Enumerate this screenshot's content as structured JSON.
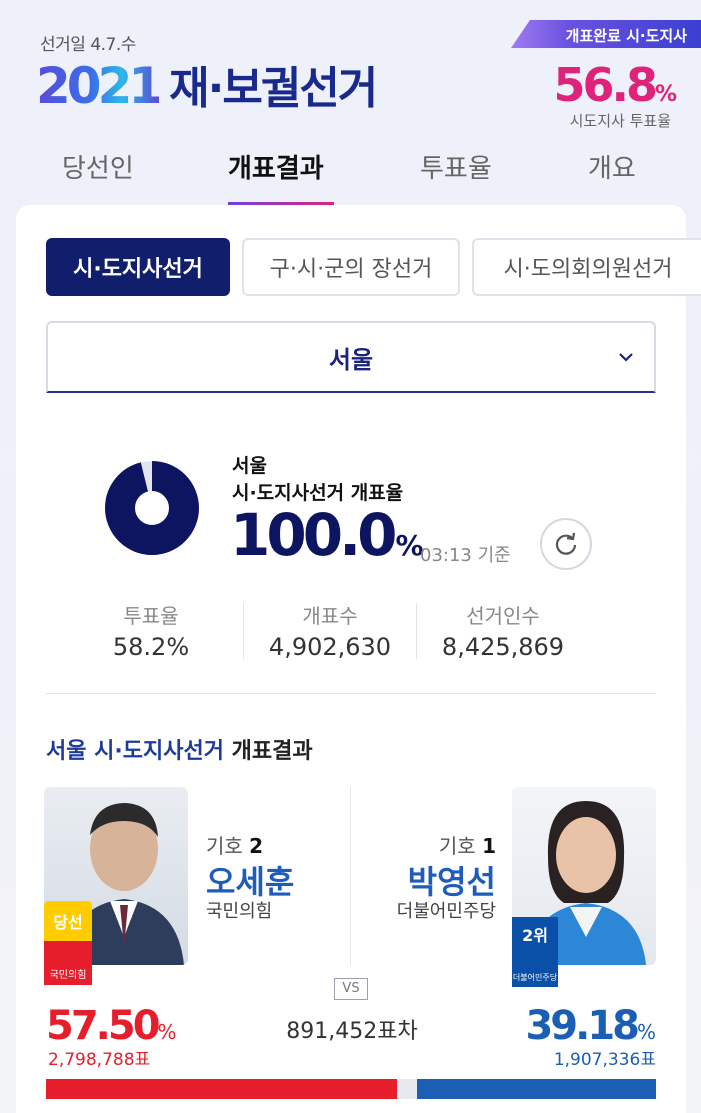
{
  "header": {
    "election_date": "선거일 4.7.수",
    "title_year": "2021",
    "title_text": "재·보궐선거",
    "status_badge": "개표완료 시·도지사",
    "turnout_value": "56.8",
    "turnout_unit": "%",
    "turnout_label": "시도지사 투표율"
  },
  "tabs": [
    {
      "label": "당선인",
      "active": false
    },
    {
      "label": "개표결과",
      "active": true
    },
    {
      "label": "투표율",
      "active": false
    },
    {
      "label": "개요",
      "active": false
    }
  ],
  "election_types": [
    {
      "label": "시·도지사선거",
      "active": true
    },
    {
      "label": "구·시·군의 장선거",
      "active": false
    },
    {
      "label": "시·도의회의원선거",
      "active": false
    }
  ],
  "region_select": {
    "value": "서울"
  },
  "count": {
    "region": "서울",
    "label": "시·도지사선거 개표율",
    "rate": "100.0",
    "rate_unit": "%",
    "rate_fraction": 0.96,
    "time": "03:13 기준"
  },
  "stats": [
    {
      "label": "투표율",
      "value": "58.2%"
    },
    {
      "label": "개표수",
      "value": "4,902,630"
    },
    {
      "label": "선거인수",
      "value": "8,425,869"
    }
  ],
  "result_title": {
    "accent": "서울 시·도지사선거",
    "rest": "개표결과"
  },
  "candidates": [
    {
      "no_label": "기호",
      "no": "2",
      "name": "오세훈",
      "party": "국민의힘",
      "badge": "당선",
      "party_logo": "국민의힘",
      "pct": "57.50",
      "pct_unit": "%",
      "votes": "2,798,788표",
      "share": 57.5,
      "color": "#e61e2b"
    },
    {
      "no_label": "기호",
      "no": "1",
      "name": "박영선",
      "party": "더불어민주당",
      "badge": "2위",
      "party_logo": "더불어민주당",
      "pct": "39.18",
      "pct_unit": "%",
      "votes": "1,907,336표",
      "share": 39.18,
      "color": "#1a5fb4"
    }
  ],
  "vs_label": "VS",
  "margin_text": "891,452표차"
}
